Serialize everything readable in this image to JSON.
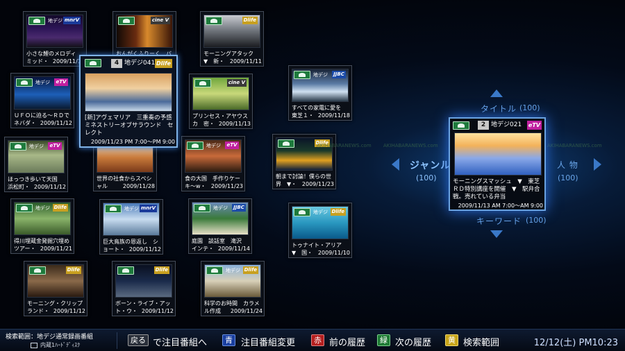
{
  "tiles": [
    {
      "net": "地デジ",
      "logo": "mnrV",
      "logo_color": "#1a3a9a",
      "title": "小さな鯉のメロディ",
      "sub": "ミッド・",
      "date": "2009/11/12"
    },
    {
      "net": "",
      "logo": "cine V",
      "logo_color": "#3a3a3a",
      "title": "おんがくふりーく　バ",
      "sub": "",
      "date": ""
    },
    {
      "net": "",
      "logo": "Dlife",
      "logo_color": "#c8a020",
      "title": "モーニングアタック",
      "sub": "▼　新・",
      "date": "2009/11/11"
    },
    {
      "net": "地デジ",
      "logo": "eTV",
      "logo_color": "#c020a0",
      "title": "ＵＦＯに迫る～ＲＤで",
      "sub": "ネバダ・",
      "date": "2009/11/12"
    },
    {
      "net": "",
      "logo": "cine V",
      "logo_color": "#3a3a3a",
      "title": "プリンセス・アヤウス",
      "sub": "カ　密・",
      "date": "2009/11/13"
    },
    {
      "net": "地デジ",
      "logo": "JJBC",
      "logo_color": "#1a4aa8",
      "title": "すべての家電に愛を",
      "sub": "東芝１・",
      "date": "2009/11/18"
    },
    {
      "net": "地デジ",
      "logo": "eTV",
      "logo_color": "#c020a0",
      "title": "ほっつき歩いて天国",
      "sub": "浜松町・",
      "date": "2009/11/12"
    },
    {
      "net": "",
      "logo": "Dlife",
      "logo_color": "#c8a020",
      "title": "世界の社食からスペシ",
      "sub": "ャル",
      "date": "2009/11/28"
    },
    {
      "net": "地デジ",
      "logo": "eTV",
      "logo_color": "#c020a0",
      "title": "食の大国　手作りケー",
      "sub": "キ～w・",
      "date": "2009/11/23"
    },
    {
      "net": "",
      "logo": "Dlife",
      "logo_color": "#c8a020",
      "title": "朝まで討論！僕らの世",
      "sub": "界　▼・",
      "date": "2009/11/23"
    },
    {
      "net": "地デジ",
      "logo": "Dlife",
      "logo_color": "#c8a020",
      "title": "得川埋蔵金発掘穴埋め",
      "sub": "ツアー・",
      "date": "2009/11/21"
    },
    {
      "net": "地デジ",
      "logo": "mnrV",
      "logo_color": "#1a3a9a",
      "title": "巨大鳥族の恩返し　シ",
      "sub": "ョート・",
      "date": "2009/11/12"
    },
    {
      "net": "地デジ",
      "logo": "JJBC",
      "logo_color": "#1a4aa8",
      "title": "庭園　談話室　滝沢",
      "sub": "インテ・",
      "date": "2009/11/14"
    },
    {
      "net": "地デジ",
      "logo": "Dlife",
      "logo_color": "#c8a020",
      "title": "トゥナイト・アリア",
      "sub": "▼　国・",
      "date": "2009/11/10"
    },
    {
      "net": "",
      "logo": "Dlife",
      "logo_color": "#c8a020",
      "title": "モーニング・クリップ",
      "sub": "ランド・",
      "date": "2009/11/12"
    },
    {
      "net": "",
      "logo": "Dlife",
      "logo_color": "#c8a020",
      "title": "ボーン・ライブ・アッ",
      "sub": "ト・ウ・",
      "date": "2009/11/12"
    },
    {
      "net": "地デジ",
      "logo": "Dlife",
      "logo_color": "#c8a020",
      "title": "科学のお時間　カラメ",
      "sub": "ル作成",
      "date": "2009/11/24"
    }
  ],
  "selected": {
    "num": "4",
    "channel": "地デジ041",
    "logo": "Dlife",
    "title": "[新]アヴェマリア　三重奏の予感　ミネストリーオブサラウンド　セレクト",
    "datetime": "2009/11/23 PM 7:00～PM 9:00"
  },
  "focus": {
    "num": "2",
    "channel": "地デジ021",
    "logo": "eTV",
    "title": "モーニングスマッシュ　▼　東芝　ＲＤ特別講座を開催　▼　駅弁合戦。売れている弁当",
    "datetime": "2009/11/13 AM 7:00～AM 9:00"
  },
  "nav": {
    "top_label": "タイトル",
    "top_count": "(100)",
    "left_label": "ジャンル",
    "left_count": "(100)",
    "right_label": "人 物",
    "right_count": "(100)",
    "bottom_label": "キーワード",
    "bottom_count": "(100)"
  },
  "watermark": "AKIHABARANEWS.com",
  "footer": {
    "scope": "検索範囲：地デジ通常録画番組",
    "disk": "内蔵1ﾊｰﾄﾞﾃﾞｨｽｸ",
    "back_key": "戻る",
    "back_text": "で注目番組へ",
    "blue_key": "青",
    "blue_text": "注目番組変更",
    "red_key": "赤",
    "red_text": "前の履歴",
    "green_key": "緑",
    "green_text": "次の履歴",
    "yellow_key": "黄",
    "yellow_text": "検索範囲",
    "clock": "12/12(土) PM10:23"
  }
}
